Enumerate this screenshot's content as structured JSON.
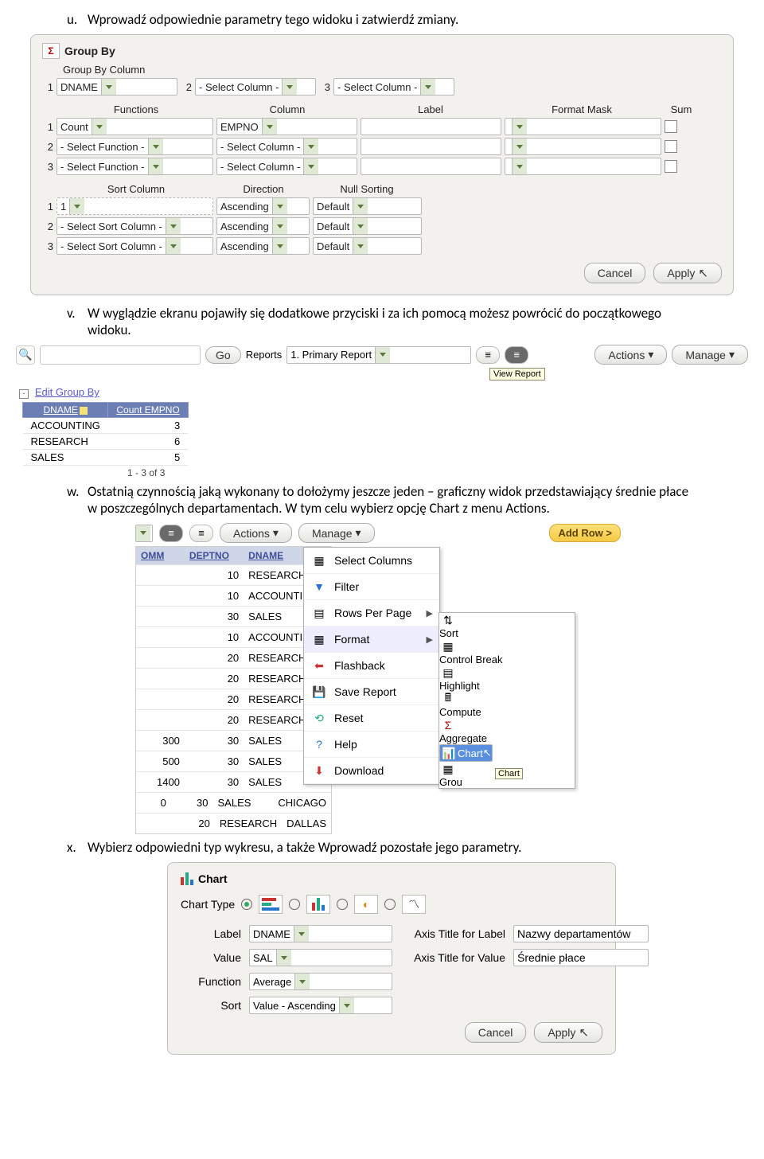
{
  "instructions": {
    "u": "Wprowadź odpowiednie parametry tego widoku i zatwierdź zmiany.",
    "v": "W wyglądzie ekranu pojawiły się dodatkowe przyciski i za ich pomocą możesz powrócić do początkowego widoku.",
    "w": "Ostatnią czynnością jaką wykonany to dołożymy jeszcze jeden – graficzny widok przedstawiający średnie płace w poszczególnych departamentach. W tym celu wybierz opcję Chart z menu Actions.",
    "x": "Wybierz odpowiedni typ wykresu, a także Wprowadź pozostałe jego parametry."
  },
  "groupby": {
    "title": "Group By",
    "section1": "Group By Column",
    "col1": "DNAME",
    "colph": "- Select Column -",
    "hdr": {
      "functions": "Functions",
      "column": "Column",
      "label": "Label",
      "mask": "Format Mask",
      "sum": "Sum"
    },
    "fn1": "Count",
    "fc1": "EMPNO",
    "fnph": "- Select Function -",
    "hdr2": {
      "sortcol": "Sort Column",
      "direction": "Direction",
      "nullsort": "Null Sorting"
    },
    "sort1": "1",
    "asc": "Ascending",
    "def": "Default",
    "sortph": "- Select Sort Column -",
    "cancel": "Cancel",
    "apply": "Apply"
  },
  "reportbar": {
    "go": "Go",
    "reports": "Reports",
    "report_sel": "1. Primary Report",
    "actions": "Actions",
    "manage": "Manage",
    "tooltip": "View Report"
  },
  "edit_group_by": "Edit Group By",
  "result": {
    "h1": "DNAME",
    "h2": "Count EMPNO",
    "rows": [
      [
        "ACCOUNTING",
        "3"
      ],
      [
        "RESEARCH",
        "6"
      ],
      [
        "SALES",
        "5"
      ]
    ],
    "page": "1 - 3 of 3"
  },
  "actions_area": {
    "cols": [
      "OMM",
      "DEPTNO",
      "DNAME"
    ],
    "rows": [
      [
        "",
        "10",
        "RESEARCH"
      ],
      [
        "",
        "10",
        "ACCOUNTING"
      ],
      [
        "",
        "30",
        "SALES"
      ],
      [
        "",
        "10",
        "ACCOUNTING"
      ],
      [
        "",
        "20",
        "RESEARCH"
      ],
      [
        "",
        "20",
        "RESEARCH"
      ],
      [
        "",
        "20",
        "RESEARCH"
      ],
      [
        "",
        "20",
        "RESEARCH"
      ],
      [
        "300",
        "30",
        "SALES"
      ],
      [
        "500",
        "30",
        "SALES"
      ],
      [
        "1400",
        "30",
        "SALES"
      ],
      [
        "0",
        "30",
        "SALES"
      ],
      [
        "",
        "20",
        "RESEARCH"
      ]
    ],
    "extra": [
      "",
      "",
      "",
      "",
      "",
      "",
      "",
      "",
      "",
      "",
      "",
      "CHICAGO",
      "DALLAS"
    ],
    "menu": [
      "Select Columns",
      "Filter",
      "Rows Per Page",
      "Format",
      "Flashback",
      "Save Report",
      "Reset",
      "Help",
      "Download"
    ],
    "submenu": [
      "Sort",
      "Control Break",
      "Highlight",
      "Compute",
      "Aggregate",
      "Chart",
      "Grou"
    ],
    "tooltip": "Chart",
    "addrow": "Add Row >"
  },
  "chart": {
    "title": "Chart",
    "type_lbl": "Chart Type",
    "label_lbl": "Label",
    "label_val": "DNAME",
    "value_lbl": "Value",
    "value_val": "SAL",
    "func_lbl": "Function",
    "func_val": "Average",
    "sort_lbl": "Sort",
    "sort_val": "Value - Ascending",
    "ax1_lbl": "Axis Title for Label",
    "ax1_val": "Nazwy departamentów",
    "ax2_lbl": "Axis Title for Value",
    "ax2_val": "Średnie płace",
    "cancel": "Cancel",
    "apply": "Apply"
  }
}
